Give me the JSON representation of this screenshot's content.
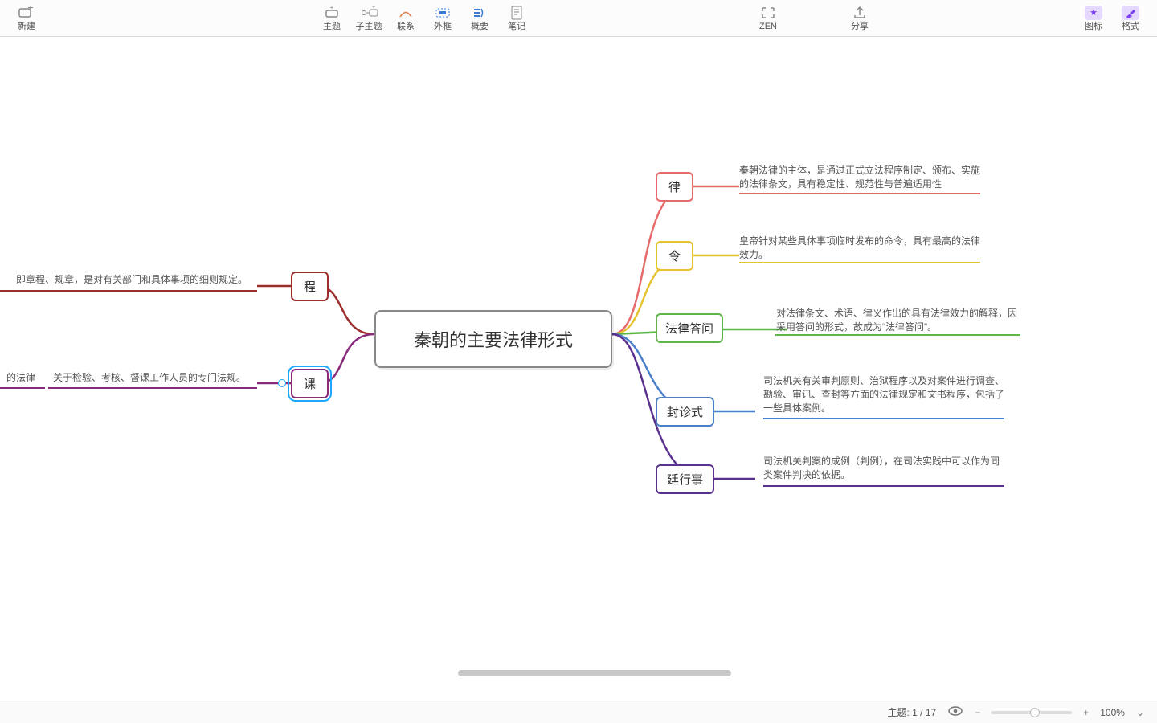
{
  "toolbar": {
    "new": "新建",
    "topic": "主题",
    "subtopic": "子主题",
    "relation": "联系",
    "boundary": "外框",
    "summary": "概要",
    "note": "笔记",
    "zen": "ZEN",
    "share": "分享",
    "icons": "图标",
    "format": "格式"
  },
  "central": {
    "title": "秦朝的主要法律形式"
  },
  "left": {
    "cheng": {
      "label": "程",
      "desc": "即章程、规章，是对有关部门和具体事项的细则规定。"
    },
    "ke": {
      "label": "课",
      "desc_a": "的法律",
      "desc_b": "关于检验、考核、督课工作人员的专门法规。"
    }
  },
  "right": {
    "lv": {
      "label": "律",
      "desc": "秦朝法律的主体，是通过正式立法程序制定、颁布、实施的法律条文，具有稳定性、规范性与普遍适用性"
    },
    "ling": {
      "label": "令",
      "desc": "皇帝针对某些具体事项临时发布的命令，具有最高的法律效力。"
    },
    "dawen": {
      "label": "法律答问",
      "desc": "对法律条文、术语、律义作出的具有法律效力的解释，因采用答问的形式，故成为“法律答问”。"
    },
    "feng": {
      "label": "封诊式",
      "desc": "司法机关有关审判原则、治狱程序以及对案件进行调查、勘验、审讯、查封等方面的法律规定和文书程序，包括了一些具体案例。"
    },
    "ting": {
      "label": "廷行事",
      "desc": "司法机关判案的成例（判例），在司法实践中可以作为同类案件判决的依据。"
    }
  },
  "colors": {
    "red": "#e76a6a",
    "orange": "#e8a23c",
    "yellow": "#e6c22f",
    "green": "#5fb647",
    "blue": "#4a7fc9",
    "purple": "#5a318f",
    "violet": "#8a2a7a",
    "darkred": "#9c2d2d"
  },
  "status": {
    "topic_label": "主题: 1 / 17",
    "zoom": "100%"
  }
}
